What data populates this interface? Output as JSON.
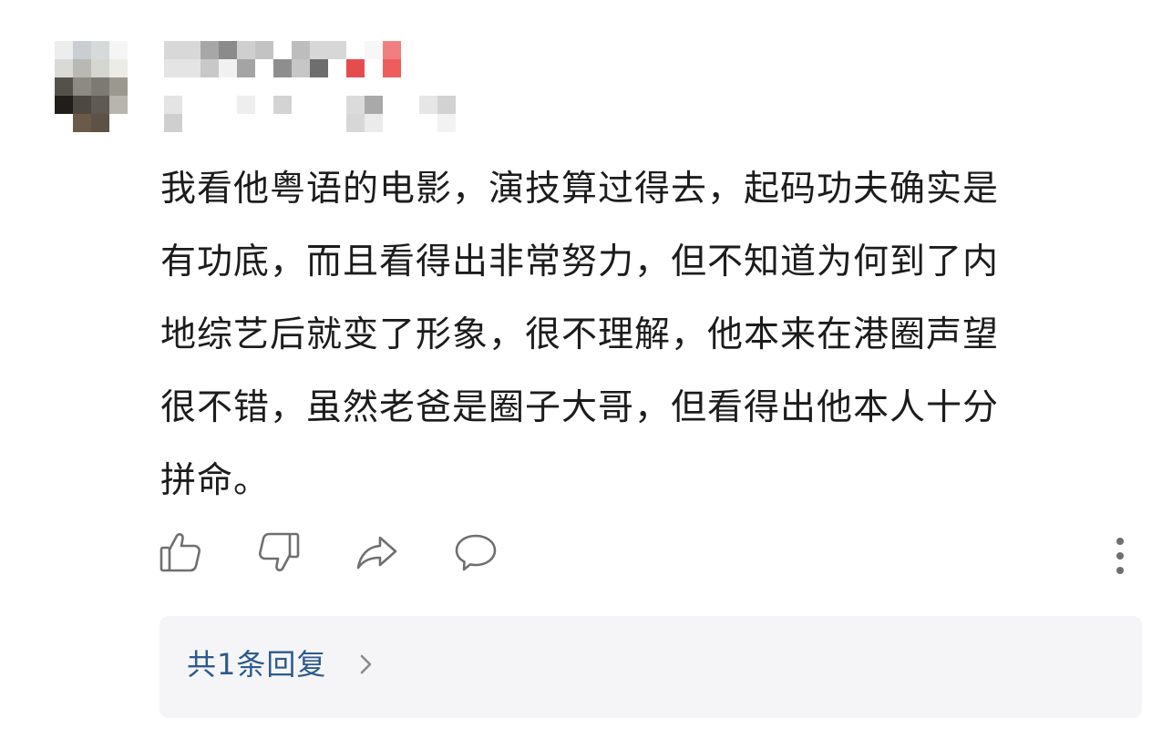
{
  "comment": {
    "text_lines": [
      "我看他粤语的电影，演技算过得去，起码功夫确实是",
      "有功底，而且看得出非常努力，但不知道为何到了内",
      "地综艺后就变了形象，很不理解，他本来在港圈声望",
      "很不错，虽然老爸是圈子大哥，但看得出他本人十分",
      "拼命。"
    ]
  },
  "actions": {
    "like_icon": "thumbs-up-icon",
    "dislike_icon": "thumbs-down-icon",
    "share_icon": "share-arrow-icon",
    "reply_icon": "speech-bubble-icon",
    "more_icon": "vertical-ellipsis-icon"
  },
  "replies": {
    "label": "共1条回复",
    "chevron_icon": "chevron-right-icon"
  },
  "colors": {
    "text": "#1c1c1c",
    "link": "#2c5a8c",
    "icon": "#6f6f6f",
    "reply_box_bg": "#f5f5f7"
  }
}
